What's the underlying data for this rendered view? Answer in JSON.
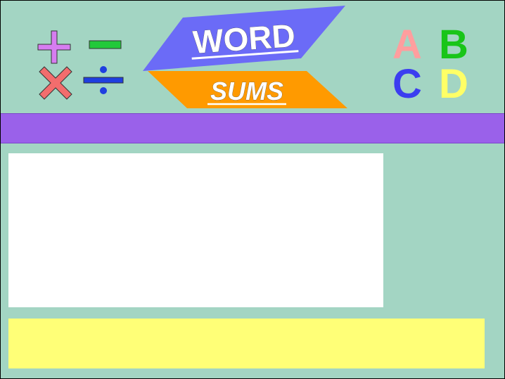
{
  "title": {
    "line1": "WORD",
    "line2": "SUMS"
  },
  "operators": [
    {
      "name": "plus-icon",
      "color": "#d67df0"
    },
    {
      "name": "minus-icon",
      "color": "#22c93a"
    },
    {
      "name": "times-icon",
      "color": "#f26d6d"
    },
    {
      "name": "divide-icon",
      "color": "#1f3fe0"
    }
  ],
  "letters": [
    {
      "text": "A",
      "color": "#ff9e9e"
    },
    {
      "text": "B",
      "color": "#19c519"
    },
    {
      "text": "C",
      "color": "#3b3df0"
    },
    {
      "text": "D",
      "color": "#ffff66"
    }
  ],
  "colors": {
    "background": "#a3d5c3",
    "band": "#9a61ea",
    "word_banner": "#6b6bf7",
    "sums_banner": "#ff9a00",
    "question_panel": "#ffffff",
    "answer_panel": "#ffff77"
  }
}
